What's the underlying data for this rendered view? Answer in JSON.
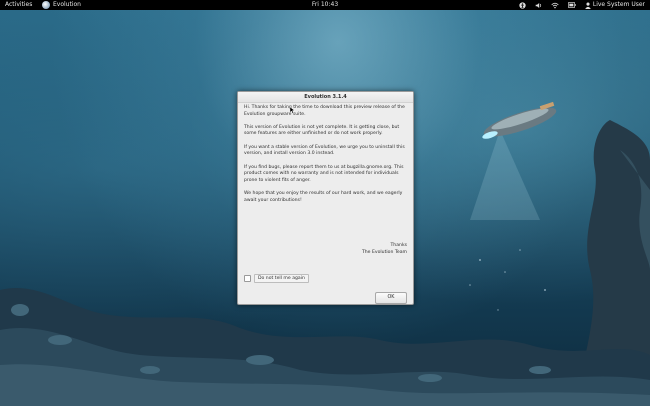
{
  "top_bar": {
    "activities_label": "Activities",
    "app_name": "Evolution",
    "clock": "Fri 10:43",
    "user_label": "Live System User",
    "icons": [
      "accessibility-icon",
      "volume-icon",
      "network-icon",
      "battery-icon",
      "user-icon"
    ]
  },
  "dialog": {
    "title": "Evolution 3.1.4",
    "paragraphs": [
      "Hi.  Thanks for taking the time to download this preview release of the Evolution groupware suite.",
      "This version of Evolution is not yet complete.  It is getting close, but some features are either unfinished or do not work properly.",
      "If you want a stable version of Evolution, we urge you to uninstall this version, and install version 3.0 instead.",
      "If you find bugs, please report them to us at bugzilla.gnome.org. This product comes with no warranty and is not intended for individuals prone to violent fits of anger.",
      "We hope that you enjoy the results of our hard work, and we eagerly await your contributions!"
    ],
    "sign_line1": "Thanks",
    "sign_line2": "The Evolution Team",
    "checkbox_label": "Do not tell me again",
    "checkbox_checked": false,
    "ok_label": "OK"
  },
  "colors": {
    "top_bar": "#000000",
    "dialog_bg": "#ededed",
    "desktop": "#1d5571"
  }
}
